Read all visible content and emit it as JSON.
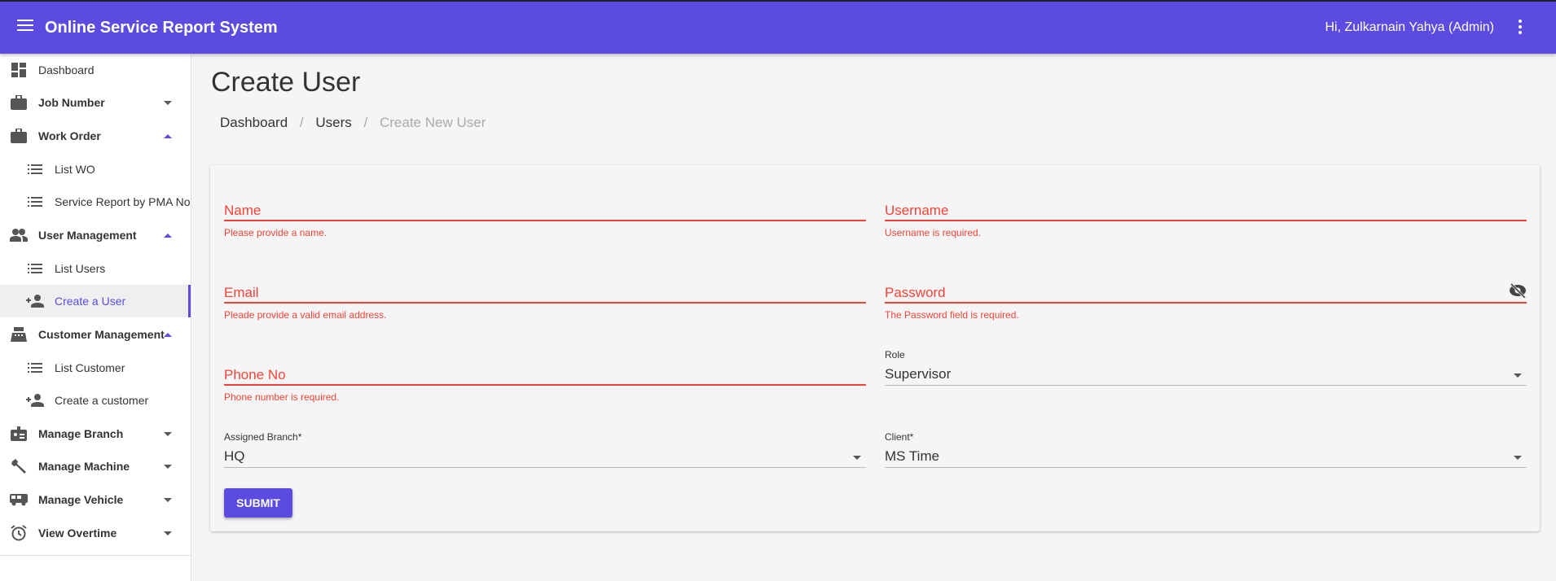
{
  "header": {
    "title": "Online Service Report System",
    "greeting": "Hi, Zulkarnain Yahya (Admin)"
  },
  "colors": {
    "brand": "#5b4be0",
    "error": "#f44336"
  },
  "sidebar": {
    "items": [
      {
        "label": "Dashboard",
        "icon": "dashboard-icon"
      },
      {
        "label": "Job Number",
        "icon": "briefcase-icon",
        "expanded": false
      },
      {
        "label": "Work Order",
        "icon": "briefcase-icon",
        "expanded": true
      },
      {
        "label": "List WO",
        "icon": "list-icon"
      },
      {
        "label": "Service Report by PMA No",
        "icon": "list-icon"
      },
      {
        "label": "User Management",
        "icon": "people-icon",
        "expanded": true
      },
      {
        "label": "List Users",
        "icon": "list-icon"
      },
      {
        "label": "Create a User",
        "icon": "person-add-icon",
        "active": true
      },
      {
        "label": "Customer Management",
        "icon": "cash-register-icon",
        "expanded": true
      },
      {
        "label": "List Customer",
        "icon": "list-icon"
      },
      {
        "label": "Create a customer",
        "icon": "person-add-icon"
      },
      {
        "label": "Manage Branch",
        "icon": "badge-icon",
        "expanded": false
      },
      {
        "label": "Manage Machine",
        "icon": "wrench-icon",
        "expanded": false
      },
      {
        "label": "Manage Vehicle",
        "icon": "bus-icon",
        "expanded": false
      },
      {
        "label": "View Overtime",
        "icon": "alarm-icon",
        "expanded": false
      }
    ]
  },
  "page": {
    "title": "Create User",
    "breadcrumb": [
      "Dashboard",
      "Users",
      "Create New User"
    ],
    "separator": "/"
  },
  "form": {
    "name": {
      "label": "Name",
      "error": "Please provide a name."
    },
    "username": {
      "label": "Username",
      "error": "Username is required."
    },
    "email": {
      "label": "Email",
      "error": "Pleade provide a valid email address."
    },
    "password": {
      "label": "Password",
      "error": "The Password field is required."
    },
    "phone": {
      "label": "Phone No",
      "error": "Phone number is required."
    },
    "role": {
      "label": "Role",
      "value": "Supervisor"
    },
    "branch": {
      "label": "Assigned Branch*",
      "value": "HQ"
    },
    "client": {
      "label": "Client*",
      "value": "MS Time"
    },
    "submit": "SUBMIT"
  }
}
